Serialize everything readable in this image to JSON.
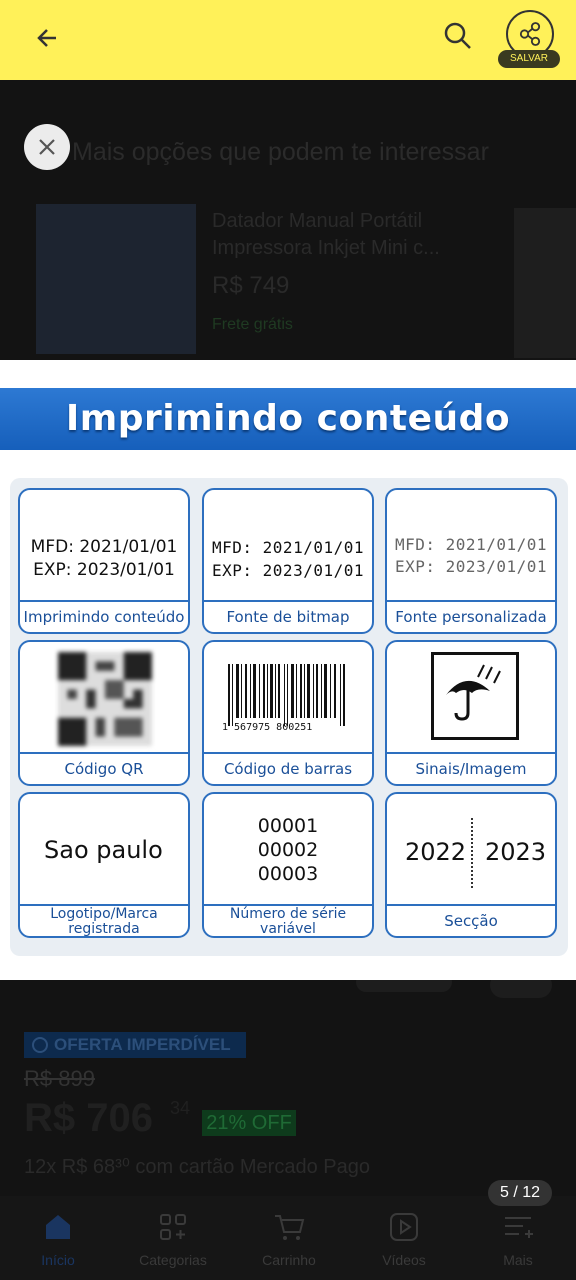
{
  "top_bar": {
    "share_badge": "SALVAR"
  },
  "recommendations": {
    "title": "Mais opções que podem te interessar",
    "card": {
      "title": "Datador Manual Portátil Impressora Inkjet Mini c...",
      "price": "R$ 749",
      "shipping": "Frete grátis"
    }
  },
  "deal": {
    "badge": "OFERTA IMPERDÍVEL",
    "old_price": "R$ 899",
    "price": "R$ 706",
    "cents": "34",
    "discount": "21% OFF",
    "installments": "12x R$ 68³⁰ com cartão Mercado Pago"
  },
  "bottom_nav": [
    {
      "label": "Início",
      "icon": "home-icon",
      "active": true
    },
    {
      "label": "Categorias",
      "icon": "categories-icon",
      "active": false
    },
    {
      "label": "Carrinho",
      "icon": "cart-icon",
      "active": false
    },
    {
      "label": "Vídeos",
      "icon": "video-icon",
      "active": false
    },
    {
      "label": "Mais",
      "icon": "menu-icon",
      "active": false
    }
  ],
  "viewer": {
    "page_counter": "5 / 12",
    "image": {
      "banner_title": "Imprimindo conteúdo",
      "cells": [
        {
          "label": "Imprimindo conteúdo",
          "lines": [
            "MFD: 2021/01/01",
            "EXP:  2023/01/01"
          ]
        },
        {
          "label": "Fonte de bitmap",
          "lines": [
            "MFD: 2021/01/01",
            "EXP: 2023/01/01"
          ]
        },
        {
          "label": "Fonte personalizada",
          "lines": [
            "MFD: 2021/01/01",
            "EXP: 2023/01/01"
          ]
        },
        {
          "label": "Código QR"
        },
        {
          "label": "Código de barras",
          "barcode_digits": "1   567975   800251"
        },
        {
          "label": "Sinais/Imagem"
        },
        {
          "label": "Logotipo/Marca registrada",
          "text": "Sao paulo"
        },
        {
          "label": "Número de série variável",
          "serials": [
            "00001",
            "00002",
            "00003"
          ]
        },
        {
          "label": "Secção",
          "years": [
            "2022",
            "2023"
          ]
        }
      ]
    }
  },
  "colors": {
    "header_yellow": "#fff159",
    "banner_blue": "#1e6bc8",
    "cell_border": "#2d6fbf",
    "cell_label": "#1a4f98"
  }
}
